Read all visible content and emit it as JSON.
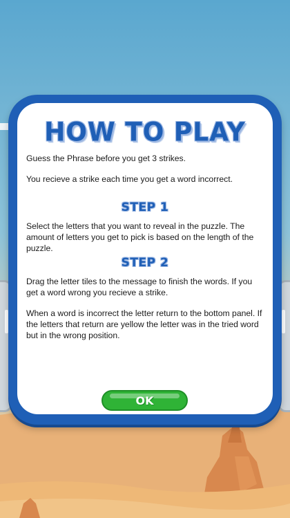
{
  "colors": {
    "sky_top": "#5da9d0",
    "sky_bottom": "#e8c89a",
    "sand": "#e2a86a",
    "rock": "#d58b55",
    "panel_border": "#1f5fb6",
    "heading": "#1f5fb6",
    "ok_button": "#2fb336"
  },
  "dialog": {
    "title": "HOW TO PLAY",
    "intro_1": "Guess the Phrase before you get 3 strikes.",
    "intro_2": "You recieve a strike each time you get a word incorrect.",
    "step1_heading": "STEP 1",
    "step1_text": "Select the letters that you want to reveal in the puzzle.  The amount of letters you get to pick is based on the length of the puzzle.",
    "step2_heading": "STEP 2",
    "step2_text": "Drag the letter tiles to the message to finish the words.  If you get a word wrong you recieve a strike.",
    "step2_text_2": "When a word is incorrect the letter return to the bottom panel.  If the letters that return are yellow the letter was in the tried word but in the wrong position.",
    "ok_label": "OK"
  }
}
